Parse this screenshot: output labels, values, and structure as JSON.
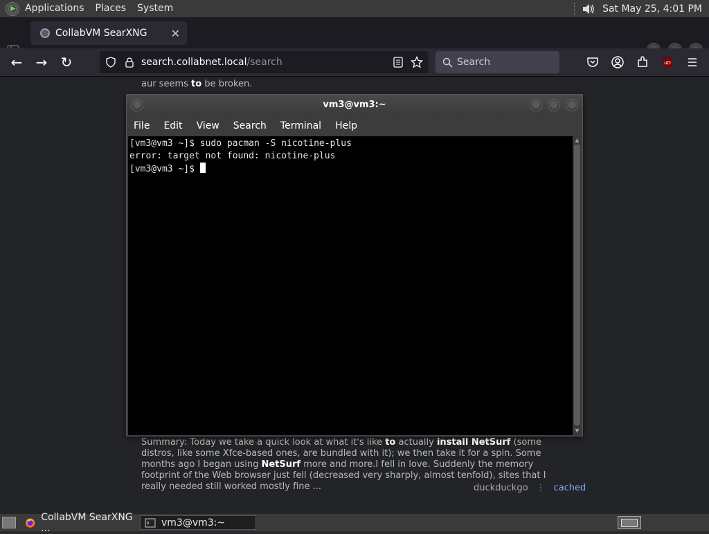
{
  "top_panel": {
    "menu": [
      "Applications",
      "Places",
      "System"
    ],
    "clock": "Sat May 25,  4:01 PM"
  },
  "browser": {
    "tab_title": "CollabVM SearXNG",
    "url_host": "search.collabnet.local",
    "url_path": "/search",
    "search_placeholder": "Search"
  },
  "page": {
    "snippet_top_pre": "aur seems ",
    "snippet_top_bold": "to",
    "snippet_top_post": " be broken.",
    "summary": {
      "p1": "Summary: Today we take a quick look at what it's like ",
      "b1": "to",
      "p2": " actually ",
      "b2": "install NetSurf",
      "p3": " (some distros, like some Xfce-based ones, are bundled with it); we then take it for a spin. Some months ago I began using ",
      "b3": "NetSurf",
      "p4": " more and more.I fell in love. Suddenly the memory footprint of the Web browser just fell (decreased very sharply, almost tenfold), sites that I really needed still worked mostly fine ..."
    },
    "engine": "duckduckgo",
    "cached_label": "cached"
  },
  "terminal": {
    "title": "vm3@vm3:~",
    "menu": [
      "File",
      "Edit",
      "View",
      "Search",
      "Terminal",
      "Help"
    ],
    "lines": [
      "[vm3@vm3 ~]$ sudo pacman -S nicotine-plus",
      "error: target not found: nicotine-plus",
      "[vm3@vm3 ~]$ "
    ]
  },
  "taskbar": {
    "tasks": [
      "CollabVM SearXNG ...",
      "vm3@vm3:~"
    ]
  }
}
